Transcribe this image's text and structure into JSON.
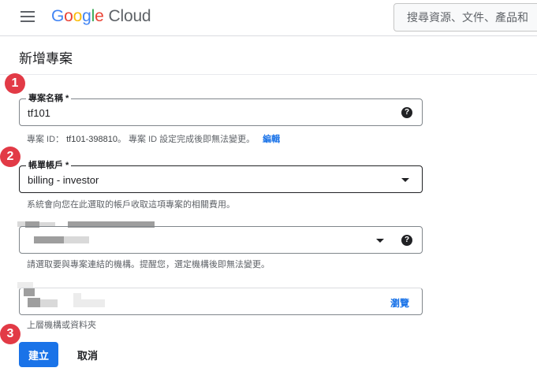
{
  "header": {
    "logo_google": "Google",
    "logo_cloud": "Cloud",
    "search_placeholder": "搜尋資源、文件、產品和"
  },
  "page": {
    "title": "新增專案"
  },
  "steps": [
    "1",
    "2",
    "3"
  ],
  "project_name": {
    "label": "專案名稱 *",
    "value": "tf101",
    "help_icon": "?",
    "hint_prefix": "專案 ID：",
    "project_id": "tf101-398810",
    "hint_suffix": "。 專案 ID 設定完成後即無法變更。",
    "edit_label": "編輯"
  },
  "billing": {
    "label": "帳單帳戶 *",
    "value": "billing - investor",
    "hint": "系統會向您在此選取的帳戶收取這項專案的相關費用。"
  },
  "organization": {
    "help_icon": "?",
    "hint": "請選取要與專案連結的機構。提醒您，選定機構後即無法變更。"
  },
  "location": {
    "browse_label": "瀏覽",
    "hint": "上層機構或資料夾"
  },
  "actions": {
    "create_label": "建立",
    "cancel_label": "取消"
  },
  "colors": {
    "primary": "#1a73e8",
    "badge": "#e23a46"
  }
}
